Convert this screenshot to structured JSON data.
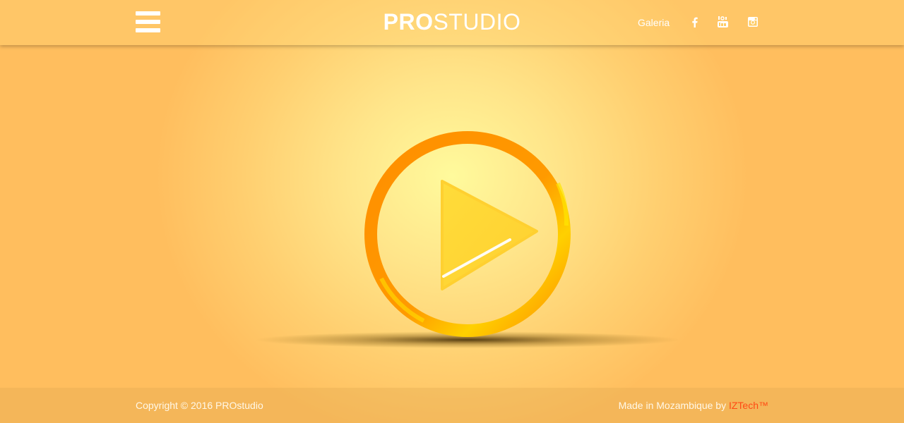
{
  "header": {
    "brand_bold": "PRO",
    "brand_light": "STUDIO",
    "nav_link": "Galeria",
    "menu_icon": "hamburger-menu-icon",
    "social": [
      "facebook-icon",
      "youtube-icon",
      "instagram-icon"
    ]
  },
  "hero": {
    "icon": "play-button-icon",
    "colors": {
      "ring": "#ff9400",
      "triangle": "#ffd43a"
    }
  },
  "footer": {
    "copyright": "Copyright © 2016 PROstudio",
    "made_in": "Made in Mozambique by ",
    "company": "IZTech™",
    "company_color": "#ff4a14"
  },
  "colors": {
    "background": "#ffcf70",
    "text": "#ffffff"
  }
}
